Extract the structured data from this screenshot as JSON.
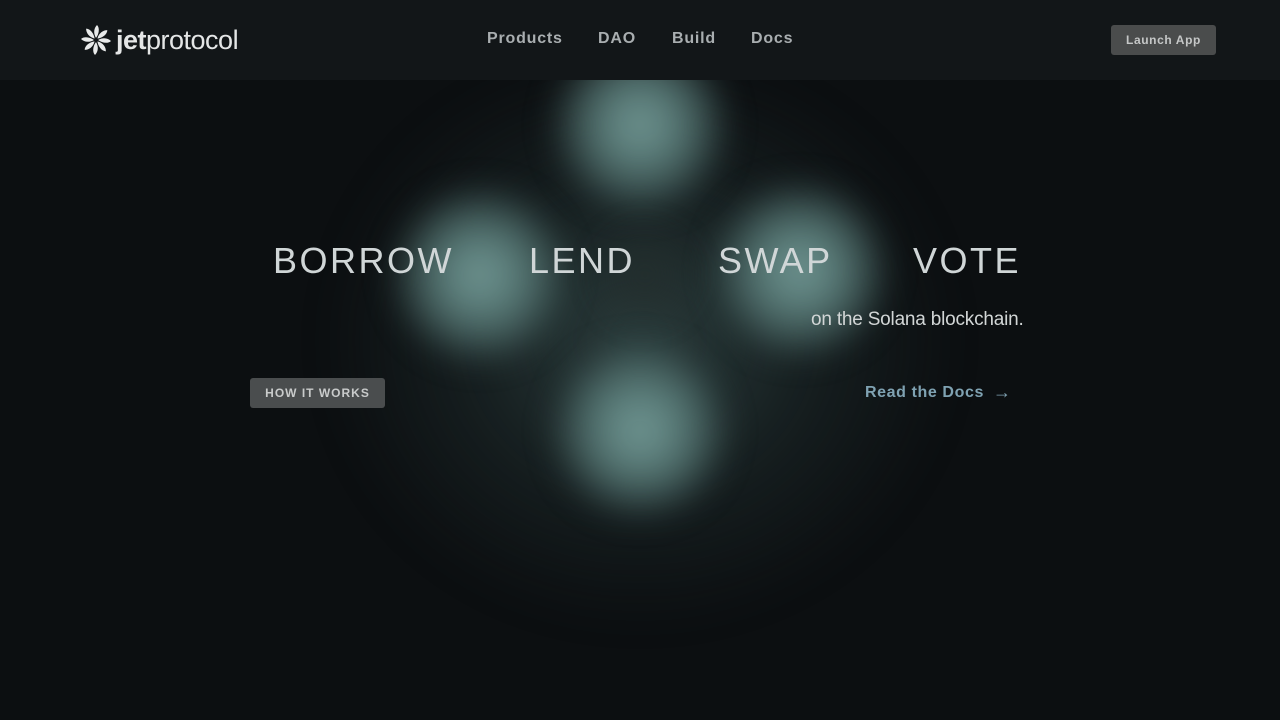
{
  "header": {
    "logo": {
      "text_bold": "jet",
      "text_light": "protocol"
    },
    "nav": [
      {
        "label": "Products"
      },
      {
        "label": "DAO"
      },
      {
        "label": "Build"
      },
      {
        "label": "Docs"
      }
    ],
    "launch_button": "Launch App"
  },
  "hero": {
    "verbs": [
      "BORROW",
      "LEND",
      "SWAP",
      "VOTE"
    ],
    "subtitle": "on the Solana blockchain.",
    "how_it_works_button": "HOW IT WORKS",
    "docs_link": {
      "label": "Read the Docs",
      "arrow": "→"
    }
  },
  "colors": {
    "background": "#0c0f11",
    "header": "#121618",
    "glow": "#78a09c",
    "link": "#7fa2b2",
    "button": "#4a4c4c"
  },
  "icons": {
    "logo": "jet-protocol-logo-icon",
    "arrow": "arrow-right-icon"
  }
}
